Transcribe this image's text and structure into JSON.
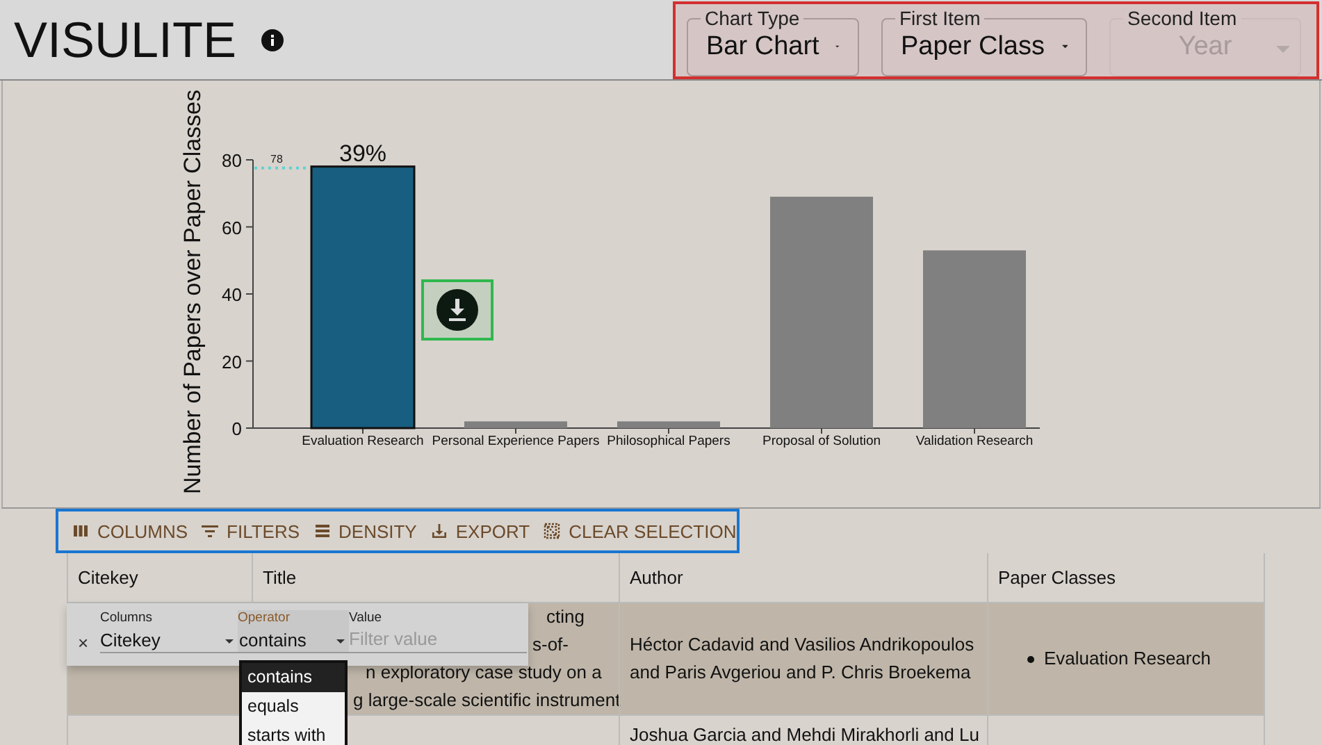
{
  "header": {
    "title": "VISULITE"
  },
  "selectors": [
    {
      "label": "Chart Type",
      "value": "Bar Chart",
      "disabled": false
    },
    {
      "label": "First Item",
      "value": "Paper Class",
      "disabled": false
    },
    {
      "label": "Second Item",
      "value": "Year",
      "disabled": true
    }
  ],
  "chart": {
    "chart_data": {
      "type": "bar",
      "ylabel": "Number of Papers over Paper Classes",
      "categories": [
        "Evaluation Research",
        "Personal Experience Papers",
        "Philosophical Papers",
        "Proposal of Solution",
        "Validation Research"
      ],
      "values": [
        78,
        2,
        2,
        69,
        53
      ],
      "yticks": [
        0,
        20,
        40,
        60,
        80
      ],
      "ylim": [
        0,
        80
      ]
    },
    "bars": [
      {
        "selected": true
      },
      {
        "selected": false
      },
      {
        "selected": false
      },
      {
        "selected": false
      },
      {
        "selected": false
      }
    ],
    "selected_percent": "39%",
    "selected_value_label": "78"
  },
  "toolbar": [
    {
      "kind": "columns",
      "label": "COLUMNS"
    },
    {
      "kind": "filters",
      "label": "FILTERS"
    },
    {
      "kind": "density",
      "label": "DENSITY"
    },
    {
      "kind": "export",
      "label": "EXPORT"
    },
    {
      "kind": "clear",
      "label": "CLEAR SELECTION"
    }
  ],
  "table": {
    "columns": [
      "Citekey",
      "Title",
      "Author",
      "Paper Classes"
    ],
    "rows": [
      {
        "selected": true,
        "title_lines": [
          "cting",
          "s-of-",
          "n exploratory case study on a",
          "g large-scale scientific instrument"
        ],
        "author": "Héctor Cadavid and Vasilios Andrikopoulos and Paris Avgeriou and P. Chris Broekema",
        "paper_classes": [
          "Evaluation Research"
        ]
      },
      {
        "selected": false,
        "author": "Joshua Garcia and Mehdi Mirakhorli and Lu"
      }
    ]
  },
  "filter_panel": {
    "close": "×",
    "column_label": "Columns",
    "column_value": "Citekey",
    "operator_label": "Operator",
    "operator_value": "contains",
    "value_label": "Value",
    "value_placeholder": "Filter value",
    "options": [
      {
        "label": "contains",
        "selected": true
      },
      {
        "label": "equals",
        "selected": false
      },
      {
        "label": "starts with",
        "selected": false
      }
    ]
  }
}
